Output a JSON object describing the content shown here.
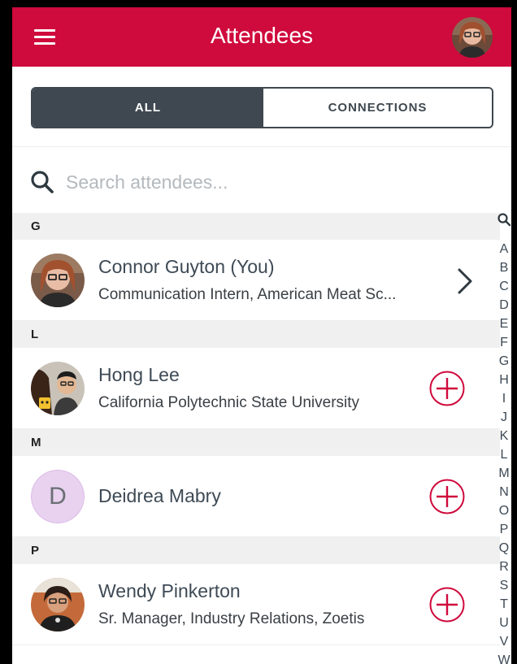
{
  "header": {
    "title": "Attendees",
    "colors": {
      "brand": "#cf0a3c"
    }
  },
  "tabs": [
    {
      "label": "ALL",
      "selected": true
    },
    {
      "label": "CONNECTIONS",
      "selected": false
    }
  ],
  "search": {
    "placeholder": "Search attendees..."
  },
  "sections": [
    {
      "letter": "G",
      "attendees": [
        {
          "name": "Connor Guyton (You)",
          "subtitle": "Communication Intern, American Meat Sc...",
          "action": "chevron-right-icon"
        }
      ]
    },
    {
      "letter": "L",
      "attendees": [
        {
          "name": "Hong Lee",
          "subtitle": "California Polytechnic State University",
          "action": "add-circle-icon"
        }
      ]
    },
    {
      "letter": "M",
      "attendees": [
        {
          "name": "Deidrea Mabry",
          "initial": "D",
          "subtitle": "",
          "action": "add-circle-icon"
        }
      ]
    },
    {
      "letter": "P",
      "attendees": [
        {
          "name": "Wendy Pinkerton",
          "subtitle": "Sr. Manager, Industry Relations, Zoetis",
          "action": "add-circle-icon"
        }
      ]
    }
  ],
  "index_bar": [
    "A",
    "B",
    "C",
    "D",
    "E",
    "F",
    "G",
    "H",
    "I",
    "J",
    "K",
    "L",
    "M",
    "N",
    "O",
    "P",
    "Q",
    "R",
    "S",
    "T",
    "U",
    "V",
    "W"
  ]
}
